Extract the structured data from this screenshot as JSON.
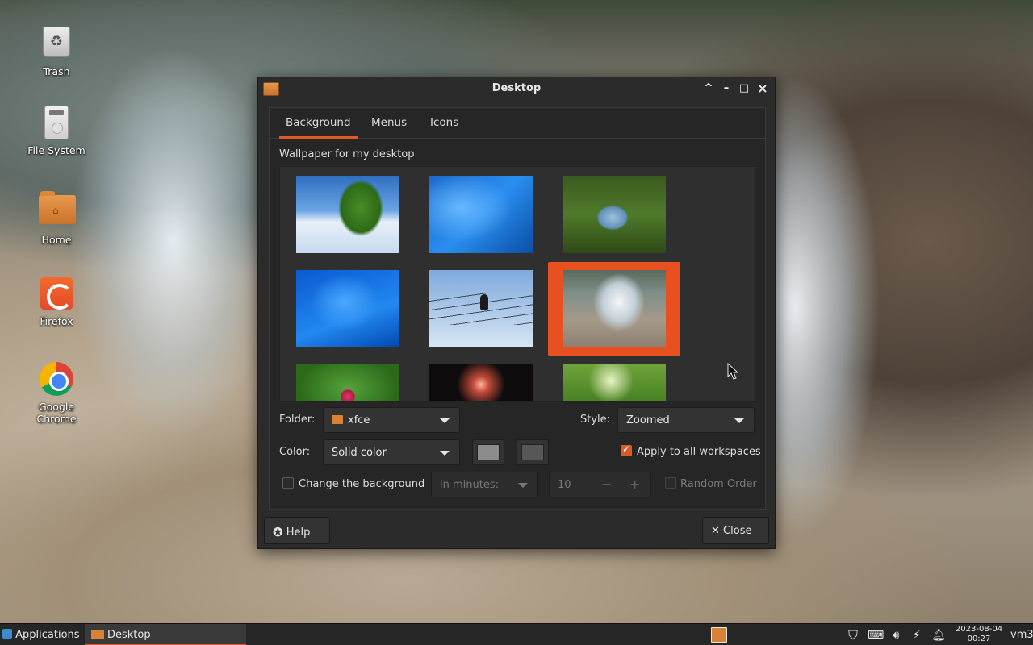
{
  "desktop": {
    "icons": [
      {
        "label": "Trash"
      },
      {
        "label": "File System"
      },
      {
        "label": "Home"
      },
      {
        "label": "Firefox"
      },
      {
        "label": "Google Chrome"
      }
    ]
  },
  "window": {
    "title": "Desktop",
    "controls": {
      "shade": "^",
      "minimize": "–",
      "maximize": "□",
      "close": "×"
    },
    "tabs": [
      "Background",
      "Menus",
      "Icons"
    ],
    "active_tab": "Background",
    "wallpaper_label": "Wallpaper for my desktop",
    "wallpapers_selected_index": 5,
    "folder": {
      "label": "Folder:",
      "value": "xfce"
    },
    "style": {
      "label": "Style:",
      "value": "Zoomed"
    },
    "color": {
      "label": "Color:",
      "value": "Solid color",
      "primary": "#8c8c8c",
      "secondary": "#575757"
    },
    "apply_all": {
      "label": "Apply to all workspaces",
      "checked": true
    },
    "change_bg": {
      "label": "Change the background",
      "checked": false
    },
    "interval": {
      "value": "in minutes:"
    },
    "interval_amount": {
      "value": "10",
      "minus": "−",
      "plus": "+"
    },
    "random_order": {
      "label": "Random Order",
      "checked": false
    },
    "help_label": "Help",
    "close_label": "Close"
  },
  "taskbar": {
    "applications_label": "Applications",
    "task_label": "Desktop",
    "clock_date": "2023-08-04",
    "clock_time": "00:27",
    "user": "vm3"
  },
  "colors": {
    "accent": "#e05a29",
    "window_bg": "#2b2b2b",
    "taskbar_bg": "#262626"
  }
}
